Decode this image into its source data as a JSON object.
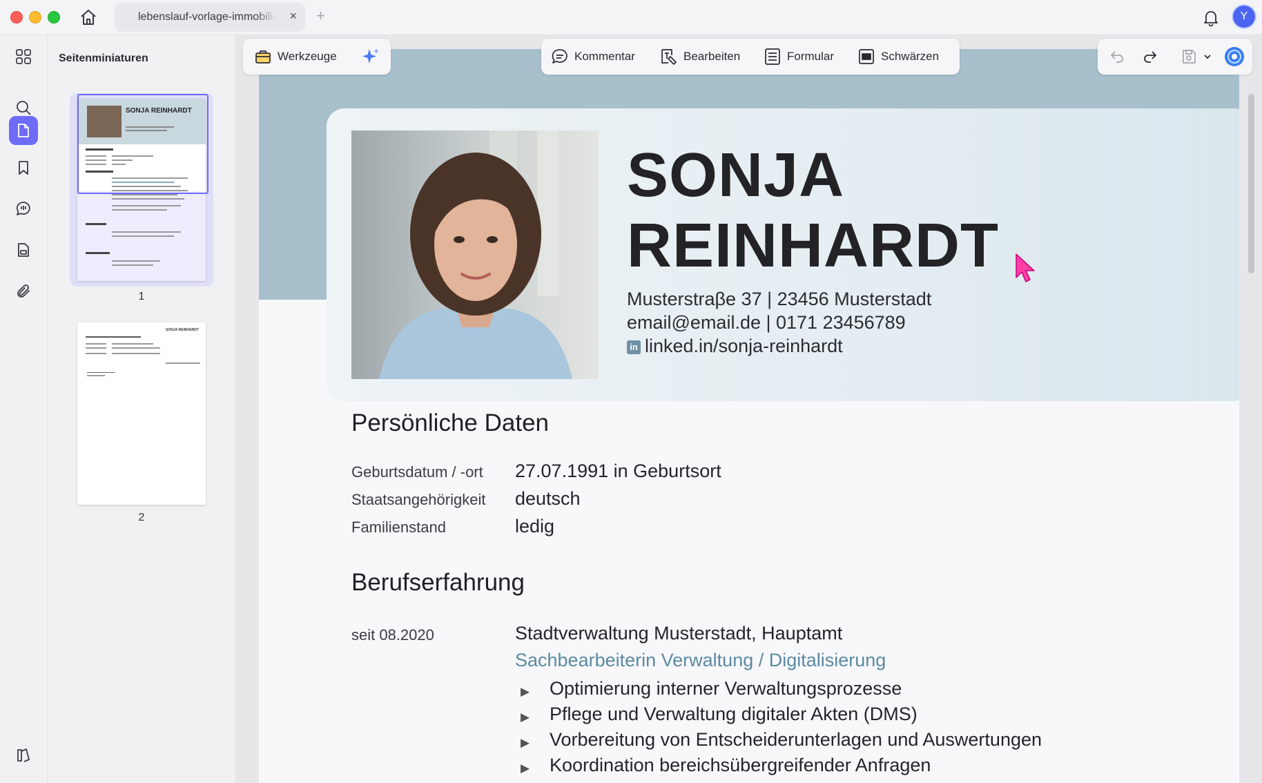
{
  "window": {
    "tab_title": "lebenslauf-vorlage-immobilienmakler.pdf",
    "tab_close": "×",
    "tab_add": "+",
    "user_initial": "Y"
  },
  "sidebar": {
    "panel_title": "Seitenminiaturen",
    "icons": [
      "thumbnails-grid-icon",
      "search-icon",
      "pages-icon",
      "bookmark-icon",
      "comment-icon",
      "document-icon",
      "attachment-icon",
      "reader-icon"
    ],
    "pages": [
      {
        "number": "1",
        "selected": true
      },
      {
        "number": "2",
        "selected": false
      }
    ],
    "thumb1": {
      "name": "SONJA REINHARDT"
    },
    "thumb2": {
      "name": "SONJA REINHARDT"
    }
  },
  "toolbar": {
    "tools_label": "Werkzeuge",
    "comment_label": "Kommentar",
    "edit_label": "Bearbeiten",
    "form_label": "Formular",
    "redact_label": "Schwärzen"
  },
  "document": {
    "name_line1": "SONJA",
    "name_line2": "REINHARDT",
    "address": "Musterstraβe 37 | 23456 Musterstadt",
    "contact": "email@email.de | 0171 23456789",
    "linkedin_badge": "in",
    "linkedin": "linked.in/sonja-reinhardt",
    "personal": {
      "heading": "Persönliche Daten",
      "rows": [
        {
          "label": "Geburtsdatum / -ort",
          "value": "27.07.1991 in Geburtsort"
        },
        {
          "label": "Staatsangehörigkeit",
          "value": "deutsch"
        },
        {
          "label": "Familienstand",
          "value": "ledig"
        }
      ]
    },
    "experience": {
      "heading": "Berufserfahrung",
      "period": "seit 08.2020",
      "employer": "Stadtverwaltung Musterstadt, Hauptamt",
      "role": "Sachbearbeiterin Verwaltung / Digitalisierung",
      "bullet_mark": "▶",
      "bullets": [
        "Optimierung interner Verwaltungsprozesse",
        "Pflege und Verwaltung digitaler Akten (DMS)",
        "Vorbereitung von Entscheiderunterlagen und Auswertungen",
        "Koordination bereichsübergreifender Anfragen"
      ]
    }
  },
  "colors": {
    "accent": "#6e6cf6",
    "header_band": "#a8bfcc",
    "role_text": "#5b8aa2"
  }
}
